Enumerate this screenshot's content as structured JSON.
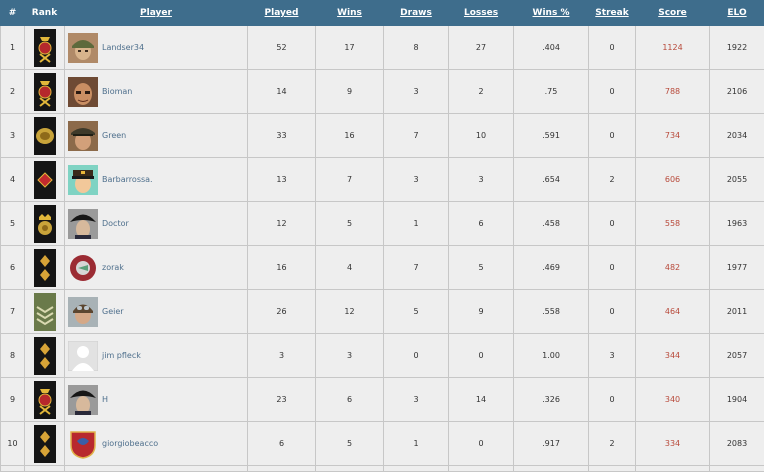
{
  "headers": {
    "num": "#",
    "rank": "Rank",
    "player": "Player",
    "played": "Played",
    "wins": "Wins",
    "draws": "Draws",
    "losses": "Losses",
    "wins_pct": "Wins %",
    "streak": "Streak",
    "score": "Score",
    "elo": "ELO"
  },
  "colors": {
    "header_bg": "#3e6d8c",
    "row_bg": "#eeeeee",
    "player_link": "#4e6f8c",
    "score_text": "#b84a3b",
    "badge_bg": "#151515"
  },
  "rows": [
    {
      "num": "1",
      "rank_icon": "general-crossed-batons-icon",
      "player": "Landser34",
      "avatar_icon": "soldier-helmet-avatar",
      "played": "52",
      "wins": "17",
      "draws": "8",
      "losses": "27",
      "wins_pct": ".404",
      "streak": "0",
      "score": "1124",
      "elo": "1922"
    },
    {
      "num": "2",
      "rank_icon": "general-crossed-batons-icon",
      "player": "Bioman",
      "avatar_icon": "face-portrait-avatar",
      "played": "14",
      "wins": "9",
      "draws": "3",
      "losses": "2",
      "wins_pct": ".75",
      "streak": "0",
      "score": "788",
      "elo": "2106"
    },
    {
      "num": "3",
      "rank_icon": "oak-wreath-icon",
      "player": "Green",
      "avatar_icon": "officer-cap-avatar",
      "played": "33",
      "wins": "16",
      "draws": "7",
      "losses": "10",
      "wins_pct": ".591",
      "streak": "0",
      "score": "734",
      "elo": "2034"
    },
    {
      "num": "4",
      "rank_icon": "diamond-rank-icon",
      "player": "Barbarrossa.",
      "avatar_icon": "cartoon-officer-avatar",
      "played": "13",
      "wins": "7",
      "draws": "3",
      "losses": "3",
      "wins_pct": ".654",
      "streak": "2",
      "score": "606",
      "elo": "2055"
    },
    {
      "num": "5",
      "rank_icon": "crown-wreath-icon",
      "player": "Doctor",
      "avatar_icon": "bicorne-hat-avatar",
      "played": "12",
      "wins": "5",
      "draws": "1",
      "losses": "6",
      "wins_pct": ".458",
      "streak": "0",
      "score": "558",
      "elo": "1963"
    },
    {
      "num": "6",
      "rank_icon": "two-diamonds-icon",
      "player": "zorak",
      "avatar_icon": "round-red-emblem-avatar",
      "played": "16",
      "wins": "4",
      "draws": "7",
      "losses": "5",
      "wins_pct": ".469",
      "streak": "0",
      "score": "482",
      "elo": "1977"
    },
    {
      "num": "7",
      "rank_icon": "chevrons-icon",
      "player": "Geier",
      "avatar_icon": "pilot-avatar",
      "played": "26",
      "wins": "12",
      "draws": "5",
      "losses": "9",
      "wins_pct": ".558",
      "streak": "0",
      "score": "464",
      "elo": "2011"
    },
    {
      "num": "8",
      "rank_icon": "two-diamonds-icon",
      "player": "jim pfleck",
      "avatar_icon": "default-user-avatar",
      "played": "3",
      "wins": "3",
      "draws": "0",
      "losses": "0",
      "wins_pct": "1.00",
      "streak": "3",
      "score": "344",
      "elo": "2057"
    },
    {
      "num": "9",
      "rank_icon": "general-crossed-batons-icon",
      "player": "H",
      "avatar_icon": "bicorne-hat-avatar",
      "played": "23",
      "wins": "6",
      "draws": "3",
      "losses": "14",
      "wins_pct": ".326",
      "streak": "0",
      "score": "340",
      "elo": "1904"
    },
    {
      "num": "10",
      "rank_icon": "two-diamonds-icon",
      "player": "giorgiobeacco",
      "avatar_icon": "shield-crest-avatar",
      "played": "6",
      "wins": "5",
      "draws": "1",
      "losses": "0",
      "wins_pct": ".917",
      "streak": "2",
      "score": "334",
      "elo": "2083"
    }
  ]
}
